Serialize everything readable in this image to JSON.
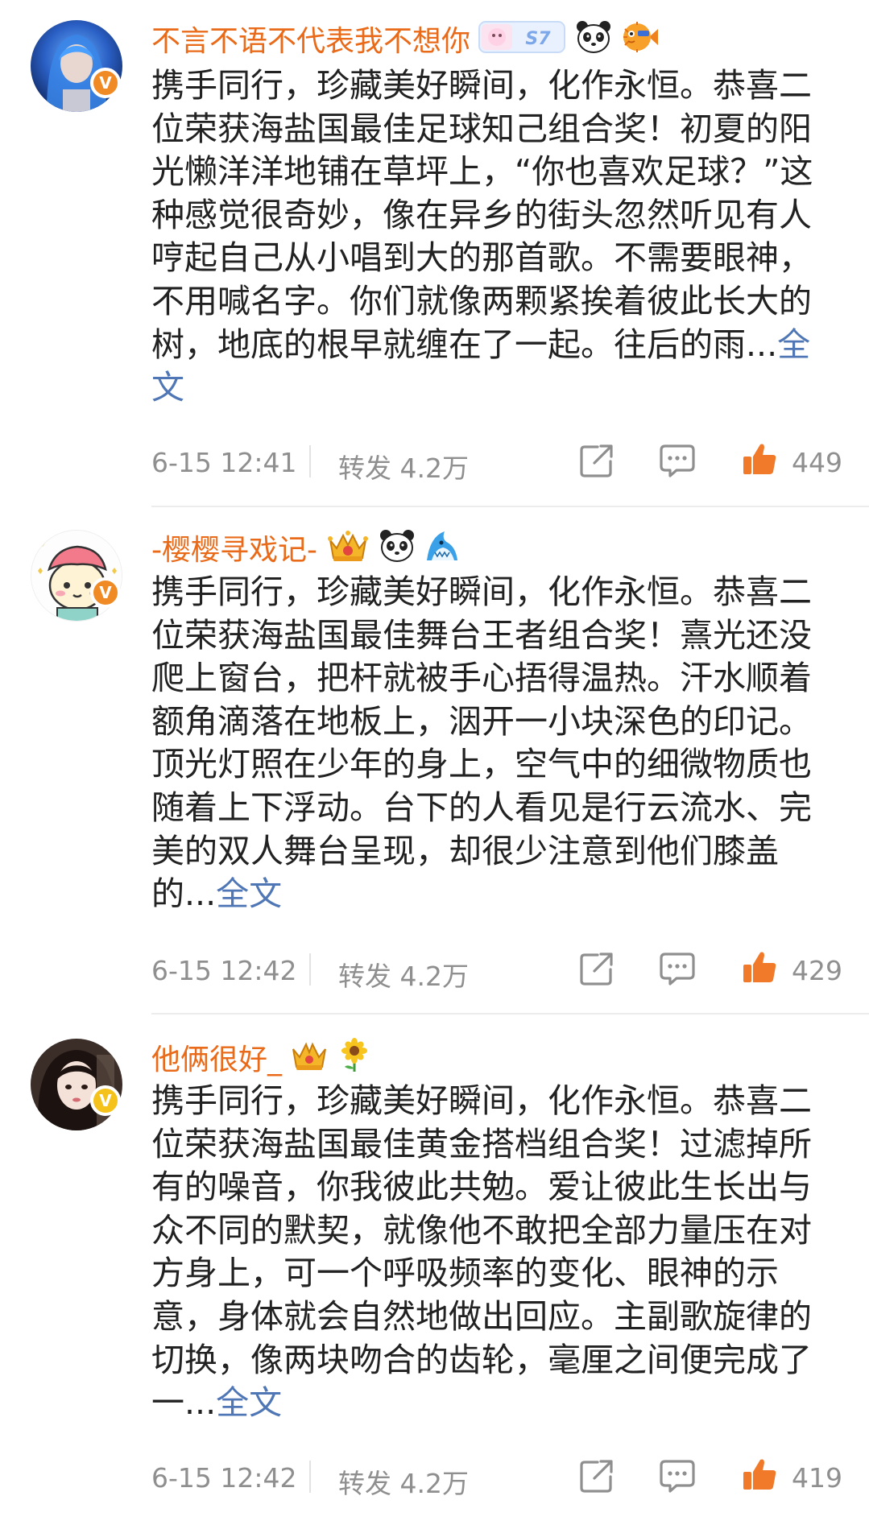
{
  "posts": [
    {
      "username": "不言不语不代表我不想你",
      "badges": [
        "star-s7-badge-icon",
        "panda-icon",
        "pufferfish-icon"
      ],
      "s7_label": "S7",
      "verified_color": "#f08a24",
      "body": "携手同行，珍藏美好瞬间，化作永恒。恭喜二位荣获海盐国最佳足球知己组合奖！初夏的阳光懒洋洋地铺在草坪上，“你也喜欢足球？”这种感觉很奇妙，像在异乡的街头忽然听见有人哼起自己从小唱到大的那首歌。不需要眼神，不用喊名字。你们就像两颗紧挨着彼此长大的树，地底的根早就缠在了一起。往后的雨...",
      "full_text_link": "全文",
      "time": "6-15 12:41",
      "repost": "转发 4.2万",
      "likes": "449"
    },
    {
      "username": "-樱樱寻戏记-",
      "badges": [
        "crown-level-badge-icon",
        "panda-icon",
        "shark-icon"
      ],
      "verified_color": "#f08a24",
      "body": "携手同行，珍藏美好瞬间，化作永恒。恭喜二位荣获海盐国最佳舞台王者组合奖！熹光还没爬上窗台，把杆就被手心捂得温热。汗水顺着额角滴落在地板上，洇开一小块深色的印记。顶光灯照在少年的身上，空气中的细微物质也随着上下浮动。台下的人看见是行云流水、完美的双人舞台呈现，却很少注意到他们膝盖的...",
      "full_text_link": "全文",
      "time": "6-15 12:42",
      "repost": "转发 4.2万",
      "likes": "429"
    },
    {
      "username": "他俩很好_",
      "badges": [
        "crown-badge-icon",
        "sunflower-icon"
      ],
      "verified_color": "#f4c21b",
      "body": "携手同行，珍藏美好瞬间，化作永恒。恭喜二位荣获海盐国最佳黄金搭档组合奖！过滤掉所有的噪音，你我彼此共勉。爱让彼此生长出与众不同的默契，就像他不敢把全部力量压在对方身上，可一个呼吸频率的变化、眼神的示意，身体就会自然地做出回应。主副歌旋律的切换，像两块吻合的齿轮，毫厘之间便完成了一...",
      "full_text_link": "全文",
      "time": "6-15 12:42",
      "repost": "转发 4.2万",
      "likes": "419"
    }
  ],
  "colors": {
    "username": "#e96b1a",
    "link": "#4f76b5",
    "meta": "#8f8f8f",
    "like_orange": "#f07a2a"
  }
}
